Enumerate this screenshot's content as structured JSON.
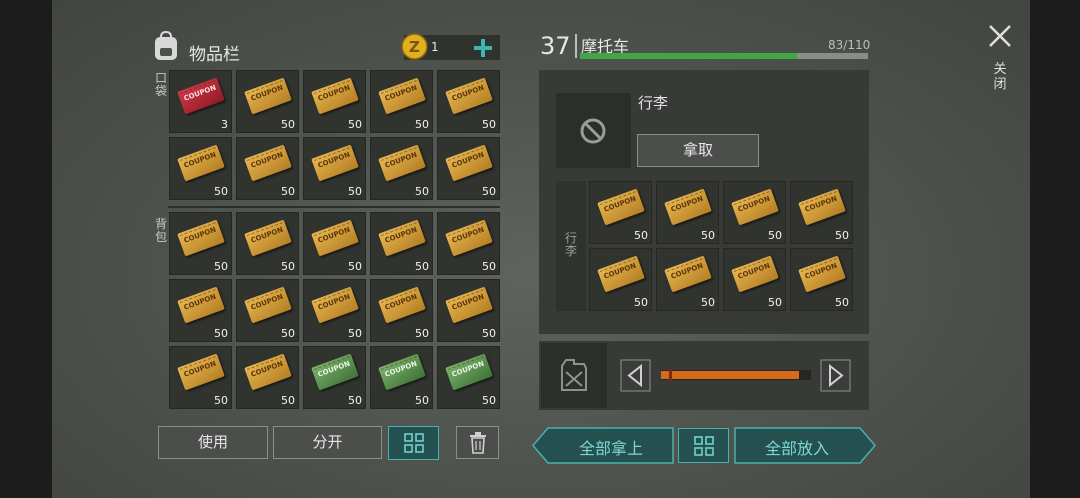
{
  "inventory": {
    "title": "物品栏",
    "coins": "1",
    "add_label": "+",
    "pocket_label": "口袋",
    "backpack_label": "背包",
    "pocket_items": [
      {
        "type": "red",
        "label": "COUPON",
        "qty": "3"
      },
      {
        "type": "gold",
        "label": "COUPON",
        "qty": "50"
      },
      {
        "type": "gold",
        "label": "COUPON",
        "qty": "50"
      },
      {
        "type": "gold",
        "label": "COUPON",
        "qty": "50"
      },
      {
        "type": "gold",
        "label": "COUPON",
        "qty": "50"
      },
      {
        "type": "gold",
        "label": "COUPON",
        "qty": "50"
      },
      {
        "type": "gold",
        "label": "COUPON",
        "qty": "50"
      },
      {
        "type": "gold",
        "label": "COUPON",
        "qty": "50"
      },
      {
        "type": "gold",
        "label": "COUPON",
        "qty": "50"
      },
      {
        "type": "gold",
        "label": "COUPON",
        "qty": "50"
      }
    ],
    "backpack_items": [
      {
        "type": "gold",
        "label": "COUPON",
        "qty": "50"
      },
      {
        "type": "gold",
        "label": "COUPON",
        "qty": "50"
      },
      {
        "type": "gold",
        "label": "COUPON",
        "qty": "50"
      },
      {
        "type": "gold",
        "label": "COUPON",
        "qty": "50"
      },
      {
        "type": "gold",
        "label": "COUPON",
        "qty": "50"
      },
      {
        "type": "gold",
        "label": "COUPON",
        "qty": "50"
      },
      {
        "type": "gold",
        "label": "COUPON",
        "qty": "50"
      },
      {
        "type": "gold",
        "label": "COUPON",
        "qty": "50"
      },
      {
        "type": "gold",
        "label": "COUPON",
        "qty": "50"
      },
      {
        "type": "gold",
        "label": "COUPON",
        "qty": "50"
      },
      {
        "type": "gold",
        "label": "COUPON",
        "qty": "50"
      },
      {
        "type": "gold",
        "label": "COUPON",
        "qty": "50"
      },
      {
        "type": "green",
        "label": "COUPON",
        "qty": "50"
      },
      {
        "type": "green",
        "label": "COUPON",
        "qty": "50"
      },
      {
        "type": "green",
        "label": "COUPON",
        "qty": "50"
      }
    ],
    "use_button": "使用",
    "split_button": "分开"
  },
  "vehicle": {
    "level": "37",
    "name": "摩托车",
    "capacity": "83/110",
    "capacity_fraction": 0.7545,
    "luggage_title": "行李",
    "take_button": "拿取",
    "luggage_side_label": "行李",
    "luggage_items": [
      {
        "type": "gold",
        "label": "COUPON",
        "qty": "50"
      },
      {
        "type": "gold",
        "label": "COUPON",
        "qty": "50"
      },
      {
        "type": "gold",
        "label": "COUPON",
        "qty": "50"
      },
      {
        "type": "gold",
        "label": "COUPON",
        "qty": "50"
      },
      {
        "type": "gold",
        "label": "COUPON",
        "qty": "50"
      },
      {
        "type": "gold",
        "label": "COUPON",
        "qty": "50"
      },
      {
        "type": "gold",
        "label": "COUPON",
        "qty": "50"
      },
      {
        "type": "gold",
        "label": "COUPON",
        "qty": "50"
      }
    ],
    "fuel_fraction": 0.92,
    "take_all_button": "全部拿上",
    "put_all_button": "全部放入"
  },
  "close_label": "关闭",
  "colors": {
    "accent_teal": "#4bb0ad",
    "capacity_green": "#3fa845",
    "fuel_orange": "#d66a1b",
    "coin_gold": "#e0b020"
  }
}
